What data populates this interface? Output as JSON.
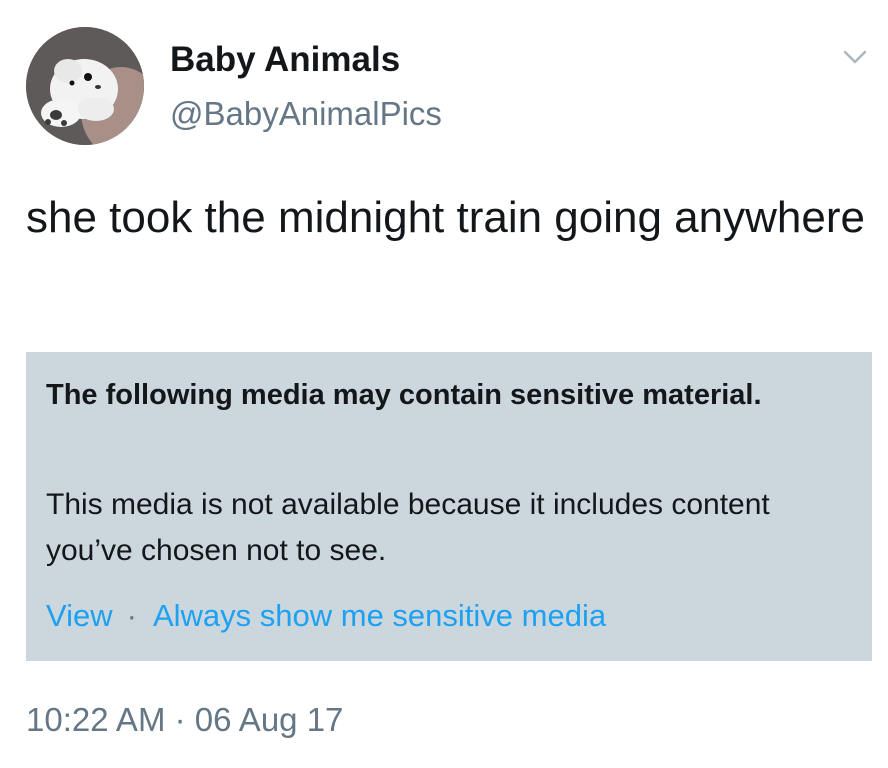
{
  "author": {
    "display_name": "Baby Animals",
    "handle": "@BabyAnimalPics",
    "avatar_icon": "puppy-avatar-icon"
  },
  "tweet": {
    "text": "she took the midnight train going anywhere",
    "timestamp": "10:22 AM · 06 Aug 17"
  },
  "sensitive_notice": {
    "title": "The following media may contain sensitive material.",
    "body": "This media is not available because it includes content you’ve chosen not to see.",
    "view_label": "View",
    "separator": "·",
    "always_show_label": "Always show me sensitive media"
  },
  "colors": {
    "text": "#14171a",
    "secondary": "#657786",
    "link": "#1da1f2",
    "notice_bg": "#ccd6dd"
  }
}
